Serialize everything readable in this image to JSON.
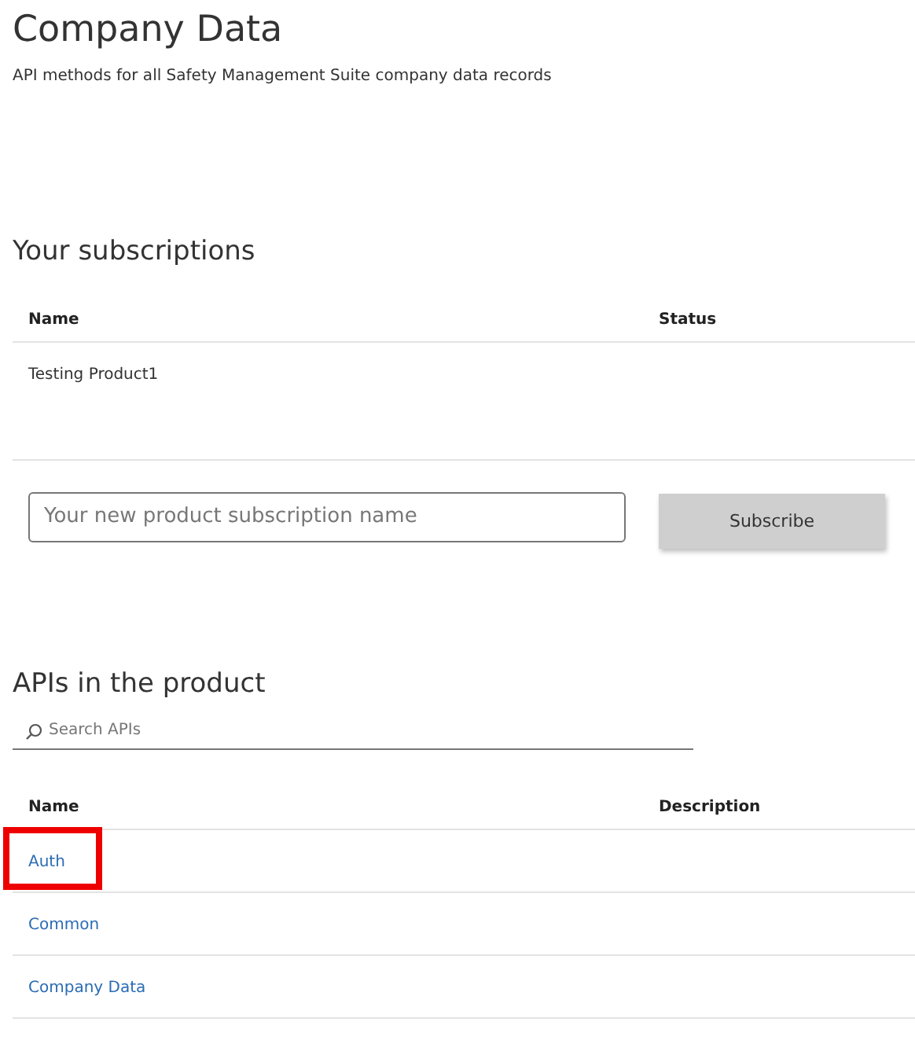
{
  "title": "Company Data",
  "subtitle": "API methods for all Safety Management Suite company data records",
  "subscriptions": {
    "heading": "Your subscriptions",
    "columns": [
      "Name",
      "Status"
    ],
    "rows": [
      {
        "name": "Testing Product1"
      }
    ],
    "new_subscription": {
      "placeholder": "Your new product subscription name"
    },
    "button": "Subscribe"
  },
  "apis": {
    "heading": "APIs in the product",
    "search": {
      "placeholder": "Search APIs"
    },
    "columns": [
      "Name",
      "Description"
    ],
    "rows": [
      {
        "name": "Auth",
        "highlighted": true
      },
      {
        "name": "Common",
        "highlighted": false
      },
      {
        "name": "Company Data",
        "highlighted": false
      }
    ]
  }
}
